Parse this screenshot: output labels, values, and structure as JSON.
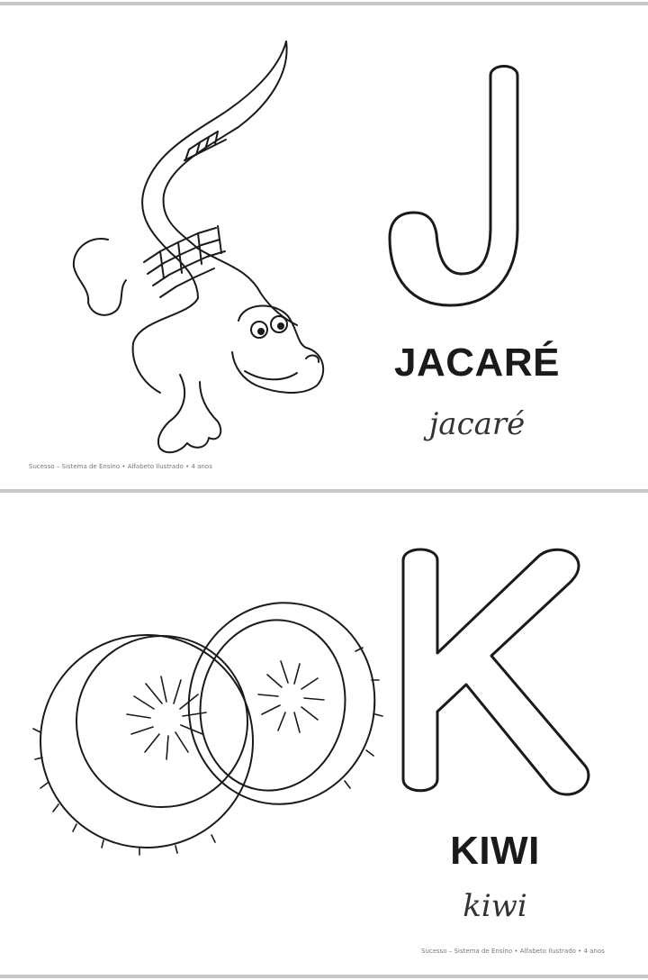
{
  "sections": [
    {
      "letter": "J",
      "word_print": "JACARÉ",
      "word_cursive": "jacaré",
      "illustration": "alligator-illustration",
      "footer": "Sucesso – Sistema de Ensino • Alfabeto Ilustrado • 4 anos"
    },
    {
      "letter": "K",
      "word_print": "KIWI",
      "word_cursive": "kiwi",
      "illustration": "kiwi-fruit-illustration",
      "footer": "Sucesso – Sistema de Ensino • Alfabeto Ilustrado • 4 anos"
    }
  ],
  "colors": {
    "ink": "#1a1a1a",
    "rule": "#c8c8c8",
    "footer": "#777777"
  }
}
